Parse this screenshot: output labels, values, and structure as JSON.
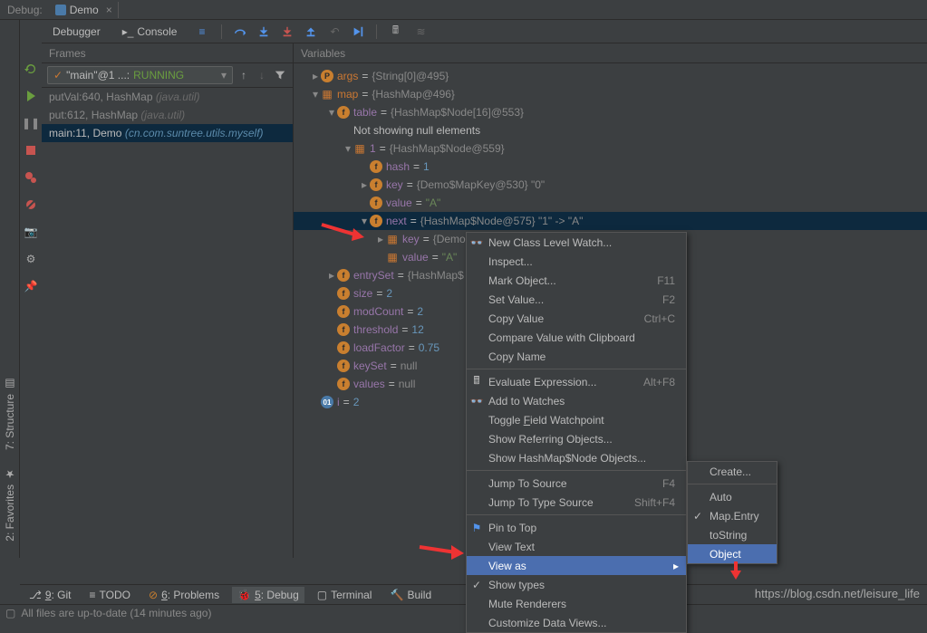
{
  "topbar": {
    "debugLabel": "Debug:",
    "runConfig": "Demo",
    "close": "×"
  },
  "toolbar": {
    "debugger": "Debugger",
    "console": "Console"
  },
  "frames": {
    "title": "Frames",
    "threadPrefix": "\"main\"@1 ...:",
    "threadStatus": "RUNNING",
    "rows": [
      {
        "method": "putVal:640, HashMap",
        "pkg": "(java.util)"
      },
      {
        "method": "put:612, HashMap",
        "pkg": "(java.util)"
      },
      {
        "method": "main:11, Demo",
        "pkg": "(cn.com.suntree.utils.myself)",
        "selected": true
      }
    ]
  },
  "vars": {
    "title": "Variables",
    "rows": [
      {
        "d": 0,
        "a": "▸",
        "b": "p",
        "name": "args",
        "val": "{String[0]@495}",
        "vo": true
      },
      {
        "d": 0,
        "a": "▾",
        "b": "o",
        "name": "map",
        "val": "{HashMap@496}",
        "vo": true
      },
      {
        "d": 1,
        "a": "▾",
        "b": "f",
        "name": "table",
        "val": "{HashMap$Node[16]@553}"
      },
      {
        "d": 2,
        "a": "",
        "b": "",
        "name": "",
        "plain": "Not showing null elements"
      },
      {
        "d": 2,
        "a": "▾",
        "b": "o",
        "name": "1",
        "val": "{HashMap$Node@559}"
      },
      {
        "d": 3,
        "a": "",
        "b": "f",
        "name": "hash",
        "val": "1",
        "num": true
      },
      {
        "d": 3,
        "a": "▸",
        "b": "f",
        "name": "key",
        "val": "{Demo$MapKey@530} \"0\""
      },
      {
        "d": 3,
        "a": "",
        "b": "f",
        "name": "value",
        "val": "\"A\"",
        "str": true
      },
      {
        "d": 3,
        "a": "▾",
        "b": "f",
        "name": "next",
        "val": "{HashMap$Node@575} \"1\" -> \"A\"",
        "sel": true
      },
      {
        "d": 4,
        "a": "▸",
        "b": "o",
        "name": "key",
        "val": "{Demo"
      },
      {
        "d": 4,
        "a": "",
        "b": "o",
        "name": "value",
        "val": "\"A\"",
        "str": true
      },
      {
        "d": 1,
        "a": "▸",
        "b": "f",
        "name": "entrySet",
        "val": "{HashMap$"
      },
      {
        "d": 1,
        "a": "",
        "b": "f",
        "name": "size",
        "val": "2",
        "num": true
      },
      {
        "d": 1,
        "a": "",
        "b": "f",
        "name": "modCount",
        "val": "2",
        "num": true
      },
      {
        "d": 1,
        "a": "",
        "b": "f",
        "name": "threshold",
        "val": "12",
        "num": true
      },
      {
        "d": 1,
        "a": "",
        "b": "f",
        "name": "loadFactor",
        "val": "0.75",
        "num": true
      },
      {
        "d": 1,
        "a": "",
        "b": "f",
        "name": "keySet",
        "val": "null"
      },
      {
        "d": 1,
        "a": "",
        "b": "f",
        "name": "values",
        "val": "null"
      },
      {
        "d": 0,
        "a": "",
        "b": "oi",
        "name": "i",
        "val": "2",
        "num": true
      }
    ]
  },
  "contextMenu": {
    "items": [
      {
        "label": "New Class Level Watch...",
        "icon": "watch"
      },
      {
        "label": "Inspect..."
      },
      {
        "label": "Mark Object...",
        "shortcut": "F11"
      },
      {
        "label": "Set Value...",
        "shortcut": "F2"
      },
      {
        "label": "Copy Value",
        "shortcut": "Ctrl+C"
      },
      {
        "label": "Compare Value with Clipboard"
      },
      {
        "label": "Copy Name"
      },
      {
        "sep": true
      },
      {
        "label": "Evaluate Expression...",
        "shortcut": "Alt+F8",
        "icon": "calc"
      },
      {
        "label": "Add to Watches",
        "icon": "glasses"
      },
      {
        "label": "Toggle Field Watchpoint",
        "u": 7
      },
      {
        "label": "Show Referring Objects..."
      },
      {
        "label": "Show HashMap$Node Objects..."
      },
      {
        "sep": true
      },
      {
        "label": "Jump To Source",
        "shortcut": "F4"
      },
      {
        "label": "Jump To Type Source",
        "shortcut": "Shift+F4"
      },
      {
        "sep": true
      },
      {
        "label": "Pin to Top",
        "icon": "pin"
      },
      {
        "label": "View Text"
      },
      {
        "label": "View as",
        "arrow": true,
        "sel": true
      },
      {
        "label": "Show types",
        "check": true
      },
      {
        "label": "Mute Renderers"
      },
      {
        "label": "Customize Data Views..."
      }
    ]
  },
  "submenu": {
    "items": [
      {
        "label": "Create..."
      },
      {
        "sep": true
      },
      {
        "label": "Auto"
      },
      {
        "label": "Map.Entry",
        "check": true
      },
      {
        "label": "toString"
      },
      {
        "label": "Object",
        "sel": true
      }
    ]
  },
  "bottomTabs": {
    "git": "9: Git",
    "todo": "TODO",
    "problems": "6: Problems",
    "debug": "5: Debug",
    "terminal": "Terminal",
    "build": "Build"
  },
  "sideTabs": {
    "structure": "7: Structure",
    "favorites": "2: Favorites"
  },
  "statusBar": {
    "msg": "All files are up-to-date (14 minutes ago)"
  },
  "watermark": "https://blog.csdn.net/leisure_life"
}
